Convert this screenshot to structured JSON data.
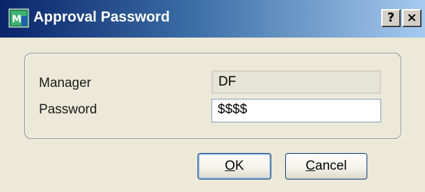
{
  "window": {
    "title": "Approval Password",
    "icon": "app-icon",
    "help_label": "?",
    "close_label": "×"
  },
  "form": {
    "manager_label": "Manager",
    "manager_value": "DF",
    "password_label": "Password",
    "password_value": "$$$$"
  },
  "buttons": {
    "ok_label": "OK",
    "cancel_label": "Cancel"
  },
  "colors": {
    "titlebar_start": "#0a246a",
    "titlebar_end": "#a6caf0",
    "dialog_bg": "#ece9d8"
  }
}
